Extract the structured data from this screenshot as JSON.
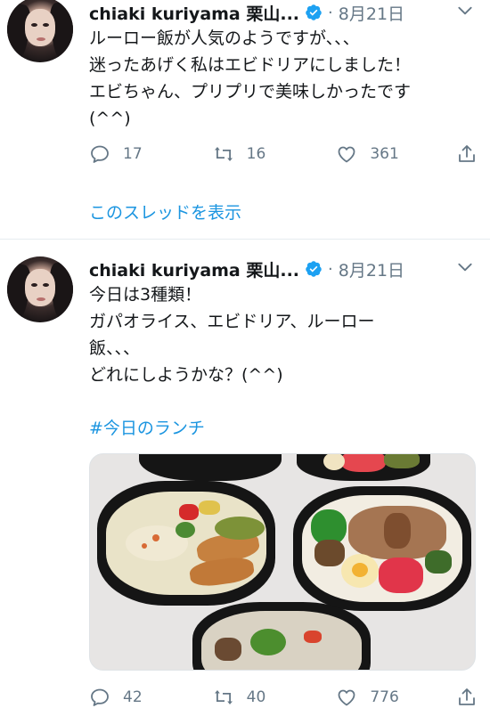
{
  "tweets": [
    {
      "name": "chiaki kuriyama 栗山...",
      "date": "8月21日",
      "text": "ルーロー飯が人気のようですが、、、\n迷ったあげく私はエビドリアにしました！\nエビちゃん、プリプリで美味しかったです\n(^^)",
      "replies": "17",
      "retweets": "16",
      "likes": "361",
      "thread_link": "このスレッドを表示"
    },
    {
      "name": "chiaki kuriyama 栗山...",
      "date": "8月21日",
      "text": "今日は3種類！\nガパオライス、エビドリア、ルーロー\n飯、、、\nどれにしようかな？(^^)",
      "hashtag": "#今日のランチ",
      "replies": "42",
      "retweets": "40",
      "likes": "776"
    }
  ],
  "colors": {
    "accent": "#1b95e0",
    "secondary_text": "#657786",
    "divider": "#e6ecf0"
  },
  "icons": [
    "verified-badge-icon",
    "chevron-down-icon",
    "reply-icon",
    "retweet-icon",
    "like-icon",
    "share-icon"
  ]
}
